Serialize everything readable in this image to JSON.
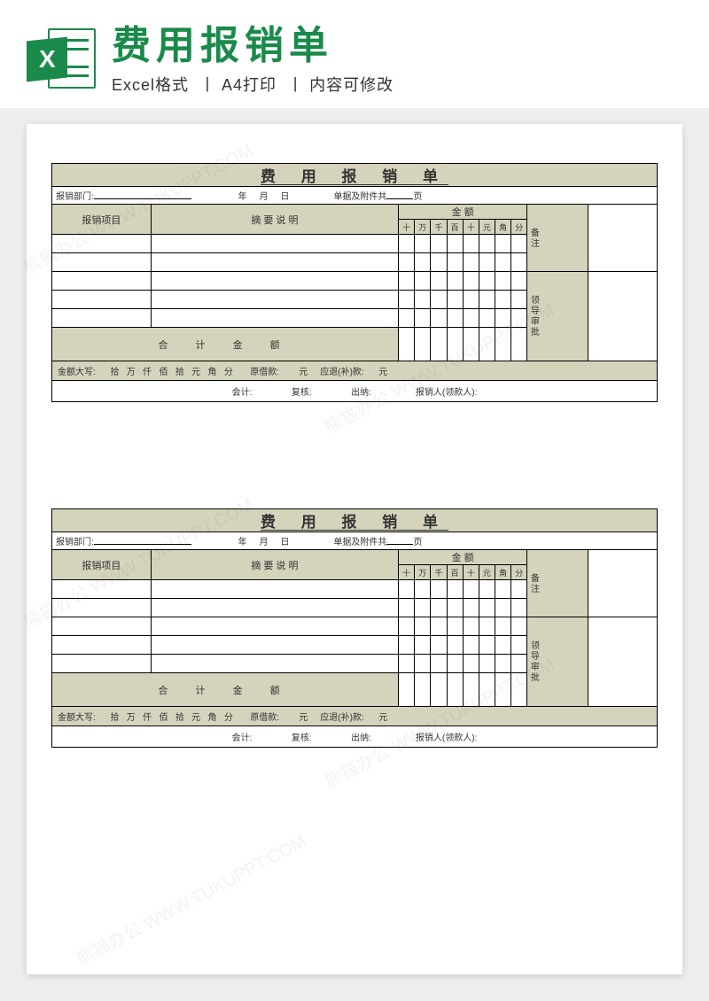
{
  "header": {
    "title": "费用报销单",
    "subtitle_parts": [
      "Excel格式",
      "A4打印",
      "内容可修改"
    ],
    "icon_letter": "X"
  },
  "form": {
    "title": "费 用 报 销 单",
    "dept_label": "报销部门:",
    "date_year": "年",
    "date_month": "月",
    "date_day": "日",
    "attach_label": "单据及附件共",
    "attach_unit": "页",
    "col_item": "报销项目",
    "col_summary": "摘 要 说 明",
    "col_amount": "金 额",
    "digits": [
      "十",
      "万",
      "千",
      "百",
      "十",
      "元",
      "角",
      "分"
    ],
    "note_label": "备注",
    "approve_label": "领导审批",
    "total_label": "合 计 金 额",
    "caps_label": "金额大写:",
    "caps_units": [
      "拾",
      "万",
      "仟",
      "佰",
      "拾",
      "元",
      "角",
      "分"
    ],
    "loan_label": "原借款:",
    "loan_unit": "元",
    "refund_label": "应退(补)款:",
    "refund_unit": "元",
    "sign_acct": "会计:",
    "sign_review": "复核:",
    "sign_cashier": "出纳:",
    "sign_claimant": "报销人(领款人):"
  },
  "watermark": "熊猫办公 WWW.TUKUPPT.COM"
}
